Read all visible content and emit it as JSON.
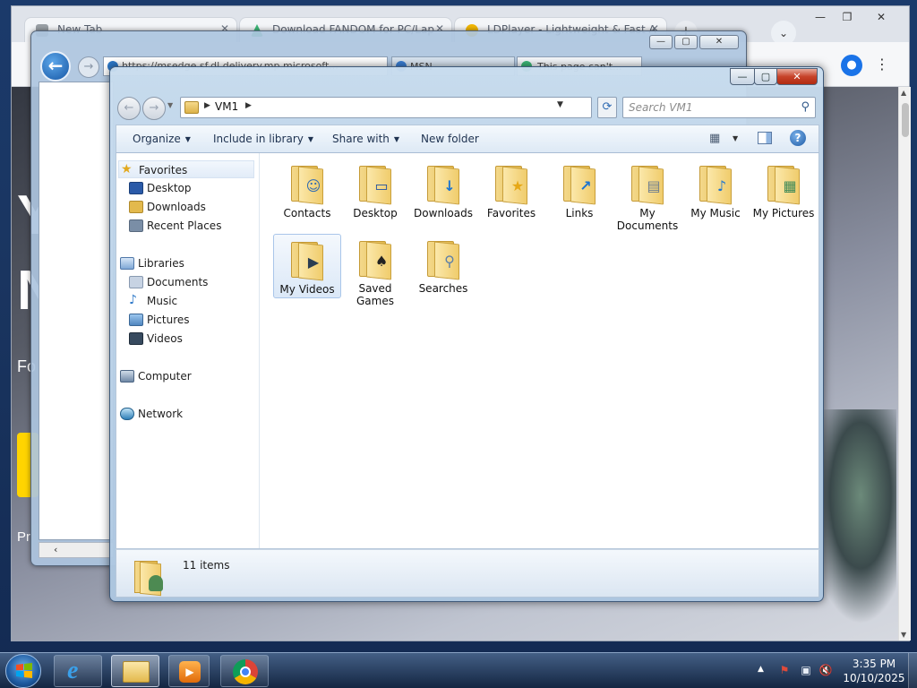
{
  "chrome": {
    "tabs": [
      {
        "title": "New Tab",
        "icon": "chrome-newtab-icon",
        "color": "#9aa0a6"
      },
      {
        "title": "Download FANDOM for PC/Lap",
        "icon": "fandom-icon",
        "color": "#3cb878"
      },
      {
        "title": "LDPlayer - Lightweight & Fast A",
        "icon": "ldplayer-icon",
        "color": "#f2b705"
      }
    ],
    "newtab_label": "+",
    "tabsearch_label": "⌄",
    "window_buttons": {
      "minimize": "—",
      "maximize": "❐",
      "close": "✕"
    },
    "toolbar_icons": [
      "profile-icon",
      "menu-icon"
    ],
    "profile_glyph": "●",
    "menu_glyph": "⋮",
    "content_text": [
      "Y",
      "N",
      "Fo",
      "Pr"
    ]
  },
  "ie": {
    "address": "https://msedge.sf.dl.delivery.mp.microsoft...",
    "tabs": [
      {
        "title": "MSN",
        "icon": "msn-icon"
      },
      {
        "title": "This page can't...",
        "icon": "ie-page-icon"
      }
    ],
    "window_buttons": {
      "minimize": "—",
      "maximize": "▢",
      "close": "✕"
    },
    "back_glyph": "←",
    "forward_glyph": "→",
    "hscroll_arrow": "‹"
  },
  "explorer": {
    "window_buttons": {
      "minimize": "—",
      "maximize": "▢",
      "close": "✕"
    },
    "breadcrumb": [
      "VM1"
    ],
    "search_placeholder": "Search VM1",
    "command_bar": {
      "organize": "Organize",
      "include_in_library": "Include in library",
      "share_with": "Share with",
      "new_folder": "New folder"
    },
    "nav": {
      "favorites": {
        "label": "Favorites",
        "items": [
          {
            "label": "Desktop",
            "icon": "desktop-icon",
            "color": "#2a5aa8"
          },
          {
            "label": "Downloads",
            "icon": "downloads-icon",
            "color": "#e3b94d"
          },
          {
            "label": "Recent Places",
            "icon": "recent-places-icon",
            "color": "#7a8ea6"
          }
        ]
      },
      "libraries": {
        "label": "Libraries",
        "items": [
          {
            "label": "Documents",
            "icon": "documents-icon",
            "color": "#c7d3e3"
          },
          {
            "label": "Music",
            "icon": "music-icon",
            "color": "#2d78c8"
          },
          {
            "label": "Pictures",
            "icon": "pictures-icon",
            "color": "#5f9dd8"
          },
          {
            "label": "Videos",
            "icon": "videos-icon",
            "color": "#374a5f"
          }
        ]
      },
      "computer": "Computer",
      "network": "Network"
    },
    "files": [
      {
        "label": "Contacts",
        "icon": "contacts-folder-icon",
        "glyph": "☺"
      },
      {
        "label": "Desktop",
        "icon": "desktop-folder-icon",
        "glyph": "▭"
      },
      {
        "label": "Downloads",
        "icon": "downloads-folder-icon",
        "glyph": "↓"
      },
      {
        "label": "Favorites",
        "icon": "favorites-folder-icon",
        "glyph": "★"
      },
      {
        "label": "Links",
        "icon": "links-folder-icon",
        "glyph": "↗"
      },
      {
        "label": "My Documents",
        "icon": "documents-folder-icon",
        "glyph": "▤"
      },
      {
        "label": "My Music",
        "icon": "music-folder-icon",
        "glyph": "♪"
      },
      {
        "label": "My Pictures",
        "icon": "pictures-folder-icon",
        "glyph": "▦"
      },
      {
        "label": "My Videos",
        "icon": "videos-folder-icon",
        "glyph": "▶",
        "selected": true
      },
      {
        "label": "Saved Games",
        "icon": "saved-games-folder-icon",
        "glyph": "♠"
      },
      {
        "label": "Searches",
        "icon": "searches-folder-icon",
        "glyph": "⚲"
      }
    ],
    "details": {
      "count_text": "11 items"
    }
  },
  "taskbar": {
    "tray_arrow": "▲",
    "tray_icons": [
      "action-center-flag-icon",
      "network-icon",
      "volume-muted-icon"
    ],
    "tray_glyphs": [
      "⚑",
      "▣",
      "🔇"
    ],
    "time": "3:35 PM",
    "date": "10/10/2025",
    "pinned": [
      {
        "name": "internet-explorer",
        "glyph": "e"
      },
      {
        "name": "windows-explorer",
        "glyph": "▭"
      },
      {
        "name": "media-player",
        "glyph": "▶"
      },
      {
        "name": "chrome",
        "glyph": "◉"
      }
    ]
  },
  "colors": {
    "accent": "#1a73e8",
    "close_red": "#c7432a",
    "folder_yellow": "#f0cc6c"
  }
}
